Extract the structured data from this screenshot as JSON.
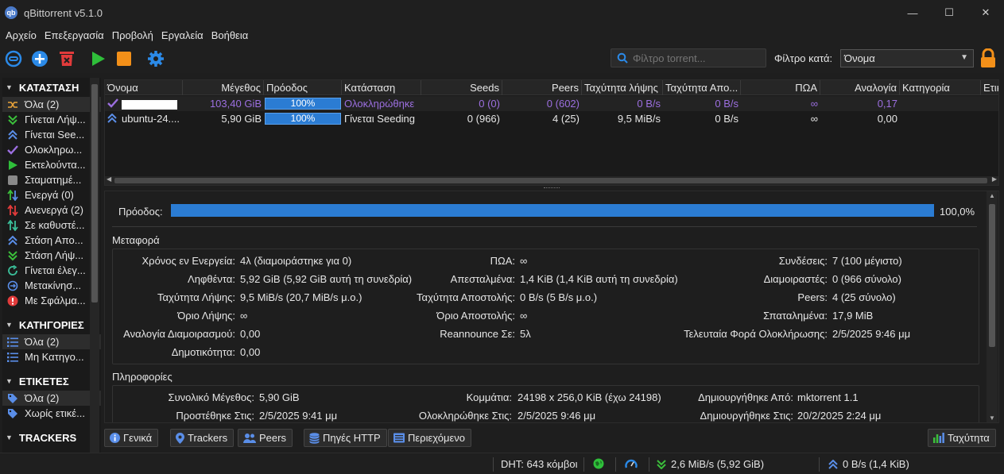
{
  "window": {
    "title": "qBittorrent v5.1.0",
    "icon_text": "qb",
    "controls": {
      "minimize": "—",
      "maximize": "☐",
      "close": "✕"
    }
  },
  "menu": [
    "Αρχείο",
    "Επεξεργασία",
    "Προβολή",
    "Εργαλεία",
    "Βοήθεια"
  ],
  "toolbar": {
    "search_placeholder": "Φίλτρο torrent...",
    "filter_label": "Φίλτρο κατά:",
    "filter_value": "Όνομα"
  },
  "sidebar": {
    "status_title": "ΚΑΤΑΣΤΑΣΗ",
    "status_items": [
      "Όλα (2)",
      "Γίνεται Λήψ...",
      "Γίνεται See...",
      "Ολοκληρω...",
      "Εκτελούντα...",
      "Σταματημέ...",
      "Ενεργά (0)",
      "Ανενεργά (2)",
      "Σε καθυστέ...",
      "Στάση Απο...",
      "Στάση Λήψ...",
      "Γίνεται έλεγ...",
      "Μετακίνησ...",
      "Με Σφάλμα..."
    ],
    "categories_title": "ΚΑΤΗΓΟΡΙΕΣ",
    "category_items": [
      "Όλα (2)",
      "Μη Κατηγο..."
    ],
    "tags_title": "ΕΤΙΚΕΤΕΣ",
    "tag_items": [
      "Όλα (2)",
      "Χωρίς ετικέ..."
    ],
    "trackers_title": "TRACKERS"
  },
  "table": {
    "headers": [
      "Όνομα",
      "Μέγεθος",
      "Πρόοδος",
      "Κατάσταση",
      "Seeds",
      "Peers",
      "Ταχύτητα λήψης",
      "Ταχύτητα Απο...",
      "ΠΩΑ",
      "Αναλογία",
      "Κατηγορία",
      "Ετικ"
    ],
    "rows": [
      {
        "name": "",
        "size": "103,40 GiB",
        "progress": "100%",
        "state": "Ολοκληρώθηκε",
        "seeds": "0 (0)",
        "peers": "0 (602)",
        "dl": "0 B/s",
        "ul": "0 B/s",
        "eta": "∞",
        "ratio": "0,17"
      },
      {
        "name": "ubuntu-24....",
        "size": "5,90 GiB",
        "progress": "100%",
        "state": "Γίνεται Seeding",
        "seeds": "0 (966)",
        "peers": "4 (25)",
        "dl": "9,5 MiB/s",
        "ul": "0 B/s",
        "eta": "∞",
        "ratio": "0,00"
      }
    ]
  },
  "props": {
    "progress_label": "Πρόοδος:",
    "progress_value": "100,0%",
    "transfer_title": "Μεταφορά",
    "transfer": {
      "c1": [
        [
          "Χρόνος εν Ενεργεία:",
          "4λ (διαμοιράστηκε για 0)"
        ],
        [
          "Ληφθέντα:",
          "5,92 GiB (5,92 GiB αυτή τη συνεδρία)"
        ],
        [
          "Ταχύτητα Λήψης:",
          "9,5 MiB/s (20,7 MiB/s μ.ο.)"
        ],
        [
          "Όριο Λήψης:",
          "∞"
        ],
        [
          "Αναλογία Διαμοιρασμού:",
          "0,00"
        ],
        [
          "Δημοτικότητα:",
          "0,00"
        ]
      ],
      "c2": [
        [
          "ΠΩΑ:",
          "∞"
        ],
        [
          "Απεσταλμένα:",
          "1,4 KiB (1,4 KiB αυτή τη συνεδρία)"
        ],
        [
          "Ταχύτητα Αποστολής:",
          "0 B/s (5 B/s μ.ο.)"
        ],
        [
          "Όριο Αποστολής:",
          "∞"
        ],
        [
          "Reannounce Σε:",
          "5λ"
        ]
      ],
      "c3": [
        [
          "Συνδέσεις:",
          "7 (100 μέγιστο)"
        ],
        [
          "Διαμοιραστές:",
          "0 (966 σύνολο)"
        ],
        [
          "Peers:",
          "4 (25 σύνολο)"
        ],
        [
          "Σπαταλημένα:",
          "17,9 MiB"
        ],
        [
          "Τελευταία Φορά Ολοκλήρωσης:",
          "2/5/2025 9:46 μμ"
        ]
      ]
    },
    "info_title": "Πληροφορίες",
    "info": {
      "c1": [
        [
          "Συνολικό Μέγεθος:",
          "5,90 GiB"
        ],
        [
          "Προστέθηκε Στις:",
          "2/5/2025 9:41 μμ"
        ]
      ],
      "c2": [
        [
          "Κομμάτια:",
          "24198 x 256,0 KiB (έχω 24198)"
        ],
        [
          "Ολοκληρώθηκε Στις:",
          "2/5/2025 9:46 μμ"
        ]
      ],
      "c3": [
        [
          "Δημιουργήθηκε Από:",
          "mktorrent 1.1"
        ],
        [
          "Δημιουργήθηκε Στις:",
          "20/2/2025 2:24 μμ"
        ]
      ]
    }
  },
  "tabs": [
    "Γενικά",
    "Trackers",
    "Peers",
    "Πηγές HTTP",
    "Περιεχόμενο"
  ],
  "speed_tab": "Ταχύτητα",
  "statusbar": {
    "dht": "DHT: 643 κόμβοι",
    "download": "2,6 MiB/s (5,92 GiB)",
    "upload": "0 B/s (1,4 KiB)"
  },
  "colors": {
    "accent": "#2b7cd3",
    "complete": "#9c6fe0",
    "bg": "#1e1e1e"
  }
}
